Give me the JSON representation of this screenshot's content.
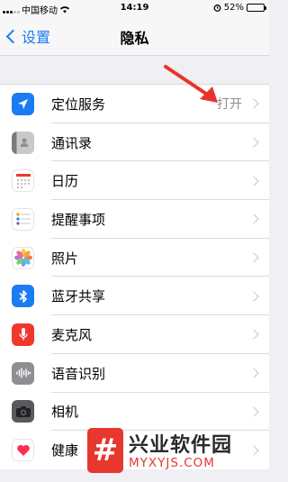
{
  "status_bar": {
    "carrier": "中国移动",
    "time": "14:19",
    "battery": "52%",
    "battery_level": 0.52
  },
  "nav": {
    "back_label": "设置",
    "title": "隐私"
  },
  "rows": [
    {
      "label": "定位服务",
      "value": "打开",
      "icon": "location-arrow-icon",
      "color": "#1a7cf2"
    },
    {
      "label": "通讯录",
      "value": "",
      "icon": "contacts-icon",
      "color": "#9b9b9b"
    },
    {
      "label": "日历",
      "value": "",
      "icon": "calendar-icon",
      "color": "#ffffff"
    },
    {
      "label": "提醒事项",
      "value": "",
      "icon": "reminders-icon",
      "color": "#ffffff"
    },
    {
      "label": "照片",
      "value": "",
      "icon": "photos-icon",
      "color": "#ffffff"
    },
    {
      "label": "蓝牙共享",
      "value": "",
      "icon": "bluetooth-icon",
      "color": "#1a7cf2"
    },
    {
      "label": "麦克风",
      "value": "",
      "icon": "microphone-icon",
      "color": "#f0372c"
    },
    {
      "label": "语音识别",
      "value": "",
      "icon": "speech-recognition-icon",
      "color": "#8e8e93"
    },
    {
      "label": "相机",
      "value": "",
      "icon": "camera-icon",
      "color": "#5a5a5e"
    },
    {
      "label": "健康",
      "value": "",
      "icon": "health-icon",
      "color": "#ffffff"
    }
  ],
  "annotation": {
    "color": "#e8332a"
  },
  "watermark": {
    "logo_text": "#",
    "name": "兴业软件园",
    "domain": "MYXYJS.COM"
  }
}
